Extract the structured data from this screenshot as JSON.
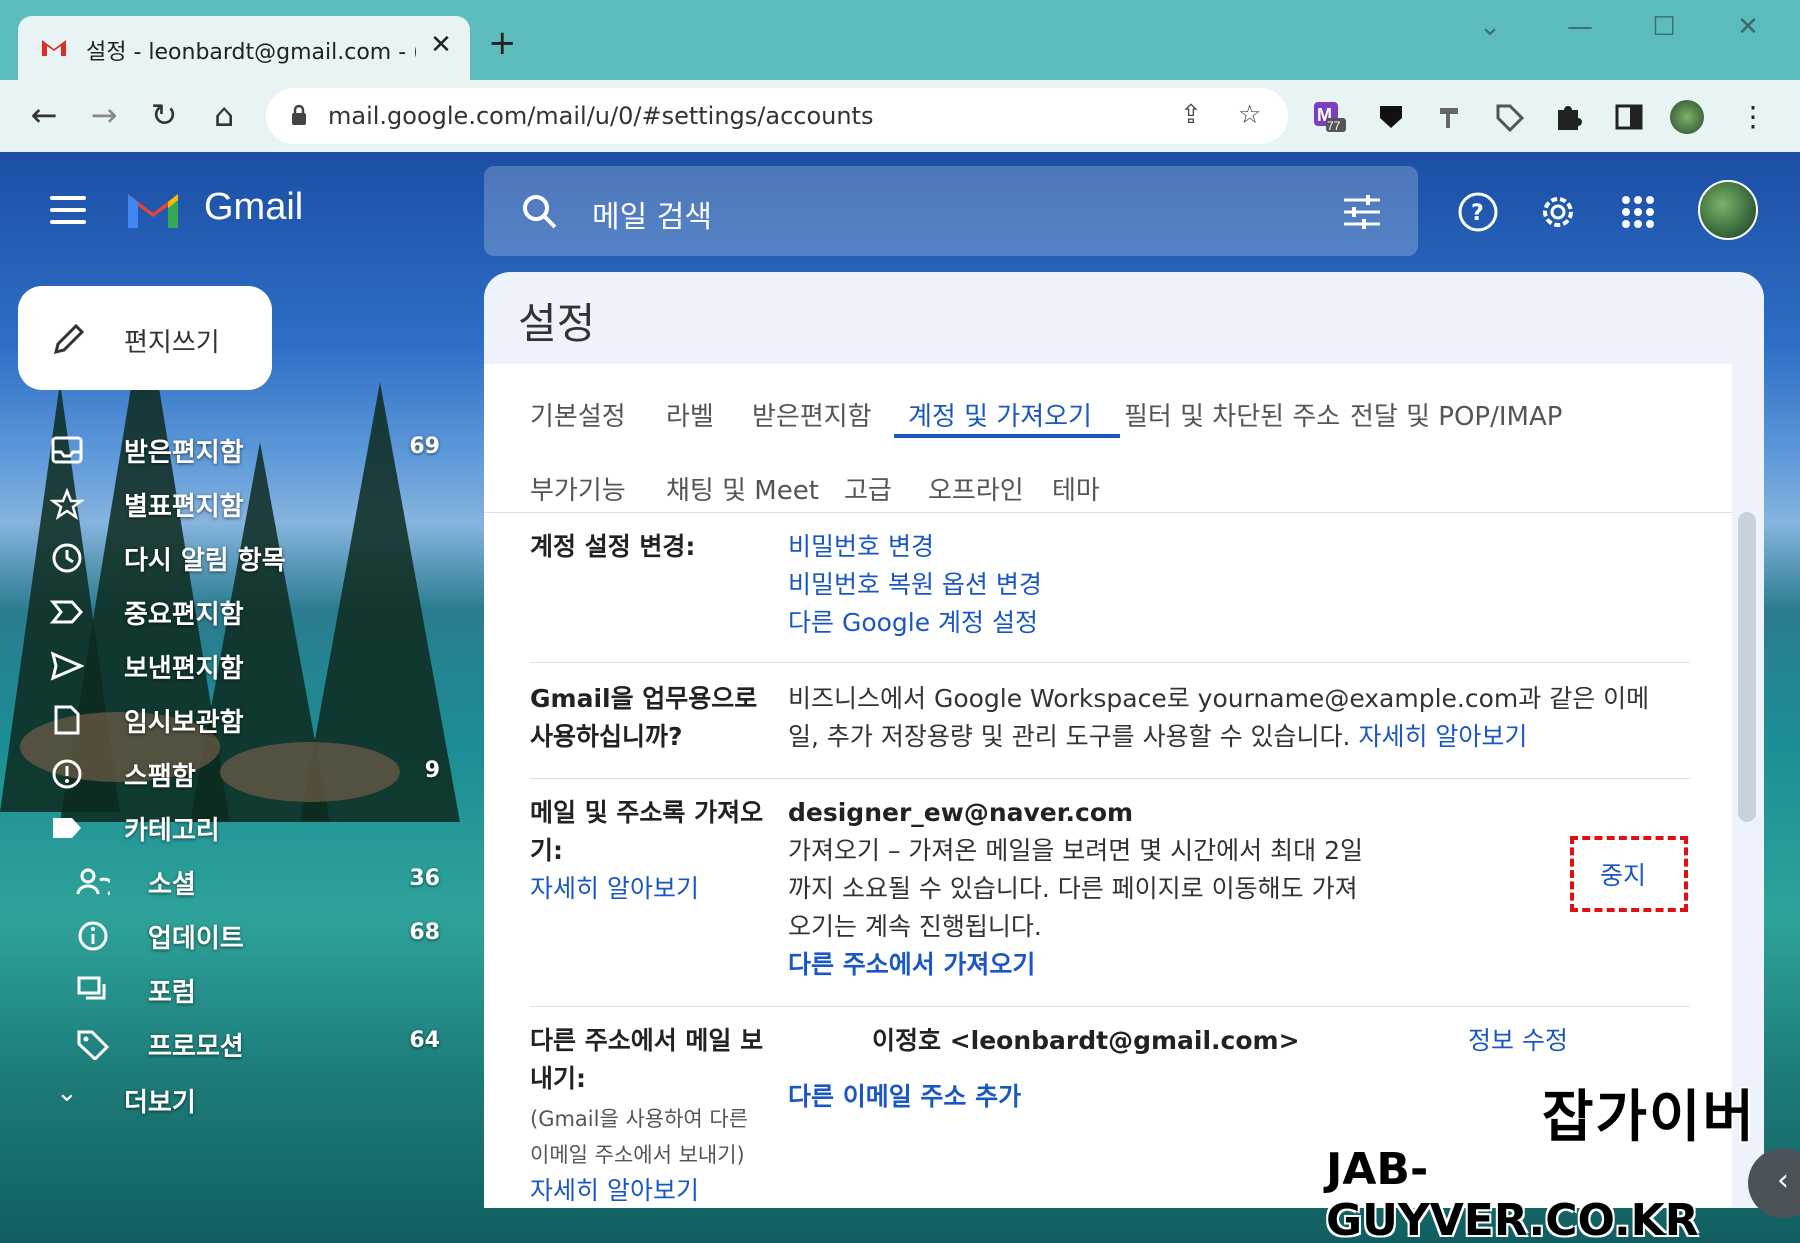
{
  "browser": {
    "tab_title": "설정 - leonbardt@gmail.com - (",
    "url": "mail.google.com/mail/u/0/#settings/accounts",
    "extension_badge": "77"
  },
  "gmail": {
    "logo_text": "Gmail",
    "search_placeholder": "메일 검색",
    "compose_label": "편지쓰기",
    "sidebar": [
      {
        "label": "받은편지함",
        "count": "69",
        "icon": "inbox-icon",
        "bold": true
      },
      {
        "label": "별표편지함",
        "count": "",
        "icon": "star-icon",
        "bold": true
      },
      {
        "label": "다시 알림 항목",
        "count": "",
        "icon": "clock-icon",
        "bold": true
      },
      {
        "label": "중요편지함",
        "count": "",
        "icon": "important-icon",
        "bold": true
      },
      {
        "label": "보낸편지함",
        "count": "",
        "icon": "send-icon",
        "bold": true
      },
      {
        "label": "임시보관함",
        "count": "",
        "icon": "draft-icon",
        "bold": true
      },
      {
        "label": "스팸함",
        "count": "9",
        "icon": "spam-icon",
        "bold": true
      },
      {
        "label": "카테고리",
        "count": "",
        "icon": "label-icon",
        "bold": true
      }
    ],
    "categories": [
      {
        "label": "소셜",
        "count": "36",
        "icon": "people-icon"
      },
      {
        "label": "업데이트",
        "count": "68",
        "icon": "info-icon"
      },
      {
        "label": "포럼",
        "count": "",
        "icon": "forum-icon"
      },
      {
        "label": "프로모션",
        "count": "64",
        "icon": "tag-icon"
      }
    ],
    "more_label": "더보기"
  },
  "settings": {
    "title": "설정",
    "tabs_row1": [
      "기본설정",
      "라벨",
      "받은편지함",
      "계정 및 가져오기",
      "필터 및 차단된 주소",
      "전달 및 POP/IMAP"
    ],
    "tabs_row2": [
      "부가기능",
      "채팅 및 Meet",
      "고급",
      "오프라인",
      "테마"
    ],
    "active_tab": "계정 및 가져오기",
    "account_section": {
      "label": "계정 설정 변경:",
      "links": [
        "비밀번호 변경",
        "비밀번호 복원 옵션 변경",
        "다른 Google 계정 설정"
      ]
    },
    "workspace_section": {
      "label_line1": "Gmail을 업무용으로",
      "label_line2": "사용하십니까?",
      "text_line1": "비즈니스에서 Google Workspace로 yourname@example.com과 같은 이메",
      "text_line2": "일, 추가 저장용량 및 관리 도구를 사용할 수 있습니다.",
      "learn_more": "자세히 알아보기"
    },
    "import_section": {
      "label_line1": "메일 및 주소록 가져오",
      "label_line2": "기:",
      "learn_more": "자세히 알아보기",
      "account": "designer_ew@naver.com",
      "status_line1": "가져오기 – 가져온 메일을 보려면 몇 시간에서 최대 2일",
      "status_line2": "까지 소요될 수 있습니다. 다른 페이지로 이동해도 가져",
      "status_line3": "오기는 계속 진행됩니다.",
      "import_link": "다른 주소에서 가져오기",
      "stop_label": "중지"
    },
    "send_as_section": {
      "label_line1": "다른 주소에서 메일 보",
      "label_line2": "내기:",
      "note_line1": "(Gmail을 사용하여 다른",
      "note_line2": "이메일 주소에서 보내기)",
      "learn_more": "자세히 알아보기",
      "identity": "이정호 <leonbardt@gmail.com>",
      "edit_label": "정보 수정",
      "add_link": "다른 이메일 주소 추가"
    }
  },
  "watermark": {
    "line1": "잡가이버",
    "line2": "JAB-GUYVER.CO.KR"
  },
  "colors": {
    "link": "#1a57c4",
    "stop_border": "#e01010",
    "chrome": "#5cbcbd"
  }
}
